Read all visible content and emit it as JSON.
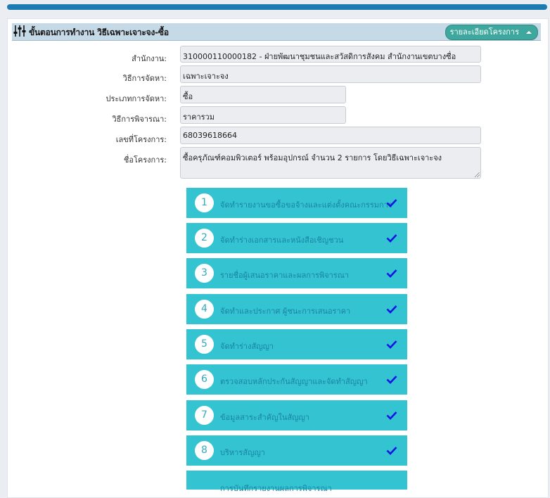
{
  "header": {
    "title": "ขั้นตอนการทำงาน วิธีเฉพาะเจาะจง-ซื้อ",
    "detail_button": "รายละเอียดโครงการ",
    "icon": "sliders-icon"
  },
  "form": {
    "agency_label": "สำนักงาน:",
    "agency_value": "310000110000182 - ฝ่ายพัฒนาชุมชนและสวัสดิการสังคม สำนักงานเขตบางซื่อ",
    "method_label": "วิธีการจัดหา:",
    "method_value": "เฉพาะเจาะจง",
    "type_label": "ประเภทการจัดหา:",
    "type_value": "ซื้อ",
    "criteria_label": "วิธีการพิจารณา:",
    "criteria_value": "ราคารวม",
    "project_no_label": "เลขที่โครงการ:",
    "project_no_value": "68039618664",
    "project_name_label": "ชื่อโครงการ:",
    "project_name_value": "ซื้อครุภัณฑ์คอมพิวเตอร์ พร้อมอุปกรณ์ จำนวน 2 รายการ โดยวิธีเฉพาะเจาะจง"
  },
  "steps": [
    {
      "num": "1",
      "label": "จัดทำรายงานขอซื้อขอจ้างและแต่งตั้งคณะกรรมการ",
      "done": true
    },
    {
      "num": "2",
      "label": "จัดทำร่างเอกสารและหนังสือเชิญชวน",
      "done": true
    },
    {
      "num": "3",
      "label": "รายชื่อผู้เสนอราคาและผลการพิจารณา",
      "done": true
    },
    {
      "num": "4",
      "label": "จัดทำและประกาศ ผู้ชนะการเสนอราคา",
      "done": true
    },
    {
      "num": "5",
      "label": "จัดทำร่างสัญญา",
      "done": true
    },
    {
      "num": "6",
      "label": "ตรวจสอบหลักประกันสัญญาและจัดทำสัญญา",
      "done": true
    },
    {
      "num": "7",
      "label": "ข้อมูลสาระสำคัญในสัญญา",
      "done": true
    },
    {
      "num": "8",
      "label": "บริหารสัญญา",
      "done": true
    },
    {
      "num": "",
      "label": "การบันทึกรายงานผลการพิจารณา",
      "done": false
    }
  ],
  "colors": {
    "accent_bar": "#1c7bb0",
    "header_bg": "#c5d9e6",
    "button_teal": "#3fa89e",
    "step_bg": "#33c3d1",
    "check_color": "#1212e6"
  }
}
